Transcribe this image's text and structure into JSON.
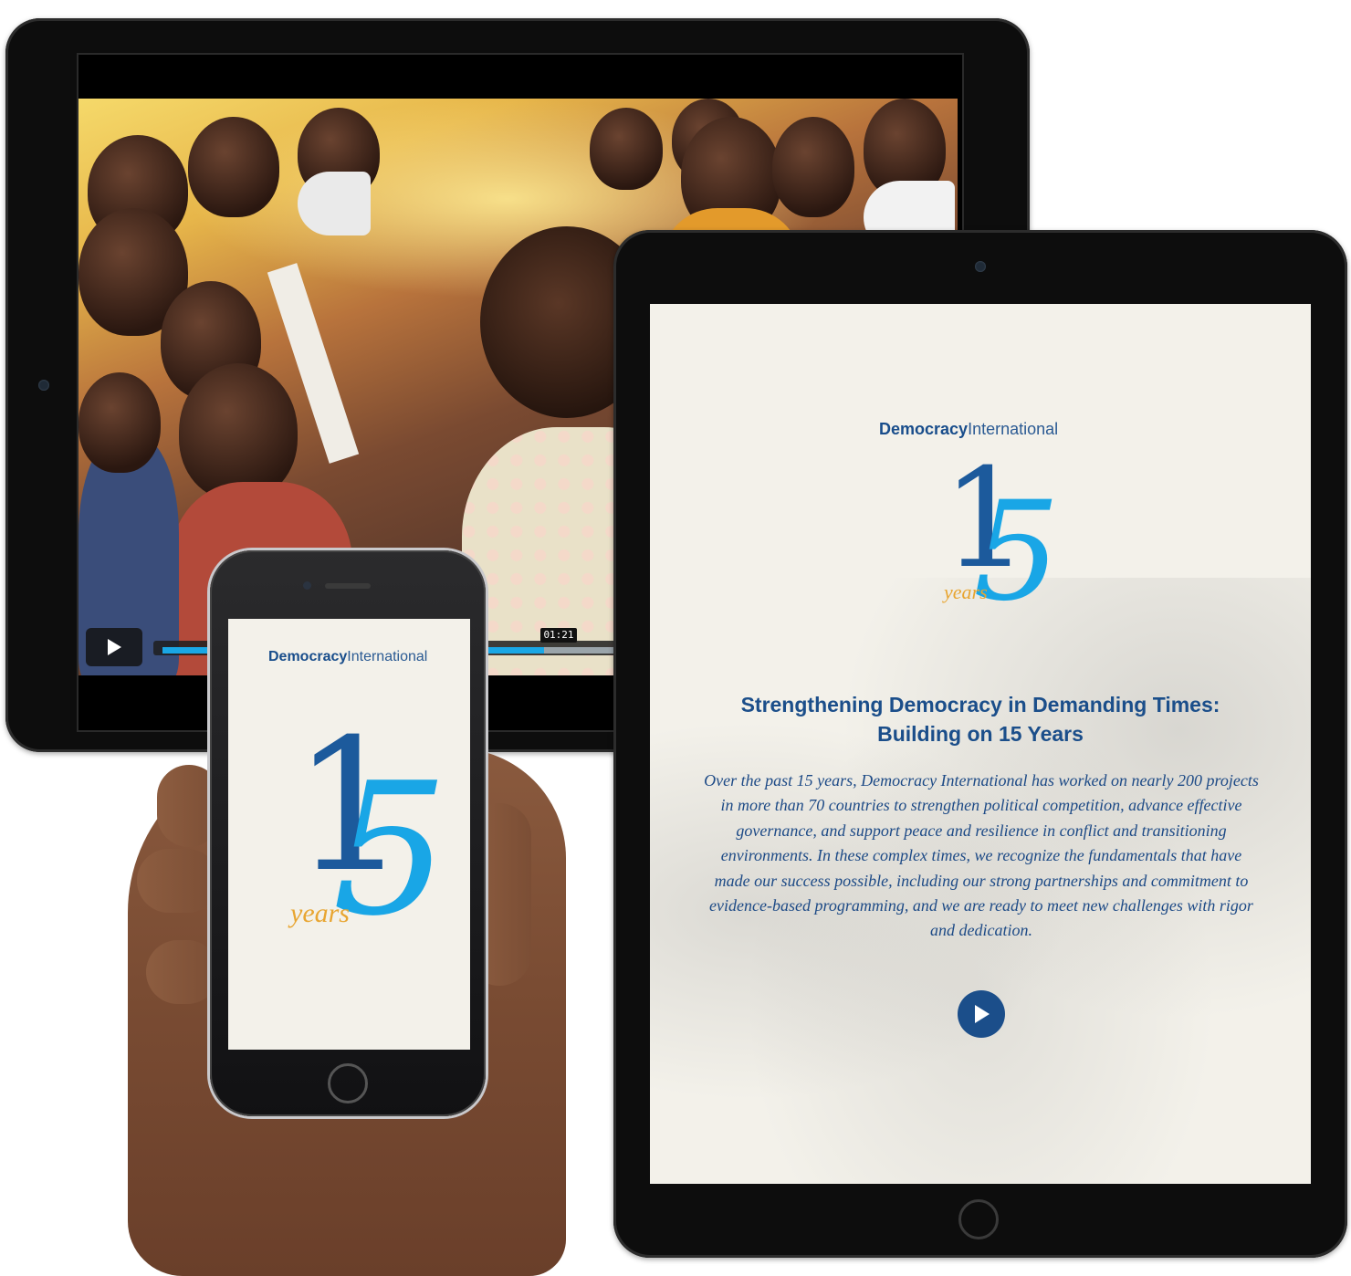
{
  "brand": {
    "name_bold": "Democracy",
    "name_light": "International",
    "logo_digit_one": "1",
    "logo_digit_five": "5",
    "logo_word": "years"
  },
  "video_player": {
    "time_label": "01:21",
    "progress": 0.49
  },
  "tablet_portrait": {
    "headline": "Strengthening Democracy in Demanding Times: Building on 15 Years",
    "body": "Over the past 15 years, Democracy International has worked on nearly 200 projects in more than 70 countries to strengthen political competition, advance effective governance, and support peace and resilience in conflict and transitioning environments. In these complex times, we recognize the fundamentals that have made our success possible, including our strong partnerships and commitment to evidence-based programming, and we are ready to meet new challenges with rigor and dedication."
  },
  "icons": {
    "video_play": "play-icon",
    "page_play": "play-circle-icon"
  },
  "colors": {
    "brand_navy": "#1b4e8a",
    "brand_cyan": "#19a6e6",
    "brand_gold": "#e8a531",
    "screen_bg": "#f3f1ea",
    "progress": "#1aa7e5"
  }
}
